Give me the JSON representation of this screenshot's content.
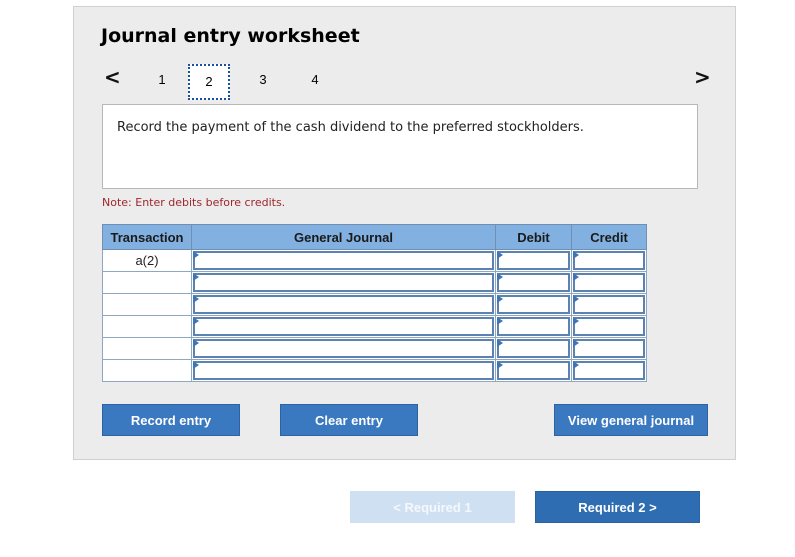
{
  "worksheet": {
    "title": "Journal entry worksheet",
    "nav": {
      "prev": "<",
      "next": ">",
      "pages": [
        "1",
        "2",
        "3",
        "4"
      ],
      "active_page": "2"
    },
    "prompt": "Record the payment of the cash dividend to the preferred stockholders.",
    "note": "Note: Enter debits before credits."
  },
  "journal_table": {
    "headers": [
      "Transaction",
      "General Journal",
      "Debit",
      "Credit"
    ],
    "rows": [
      {
        "transaction": "a(2)"
      },
      {
        "transaction": ""
      },
      {
        "transaction": ""
      },
      {
        "transaction": ""
      },
      {
        "transaction": ""
      },
      {
        "transaction": ""
      }
    ]
  },
  "buttons": {
    "record": "Record entry",
    "clear": "Clear entry",
    "view": "View general journal"
  },
  "footer": {
    "prev_label": "<  Required 1",
    "next_label": "Required 2  >"
  },
  "colors": {
    "header_bg": "#82b0e0",
    "button_bg": "#3a78bf",
    "note_text": "#a0262d"
  }
}
